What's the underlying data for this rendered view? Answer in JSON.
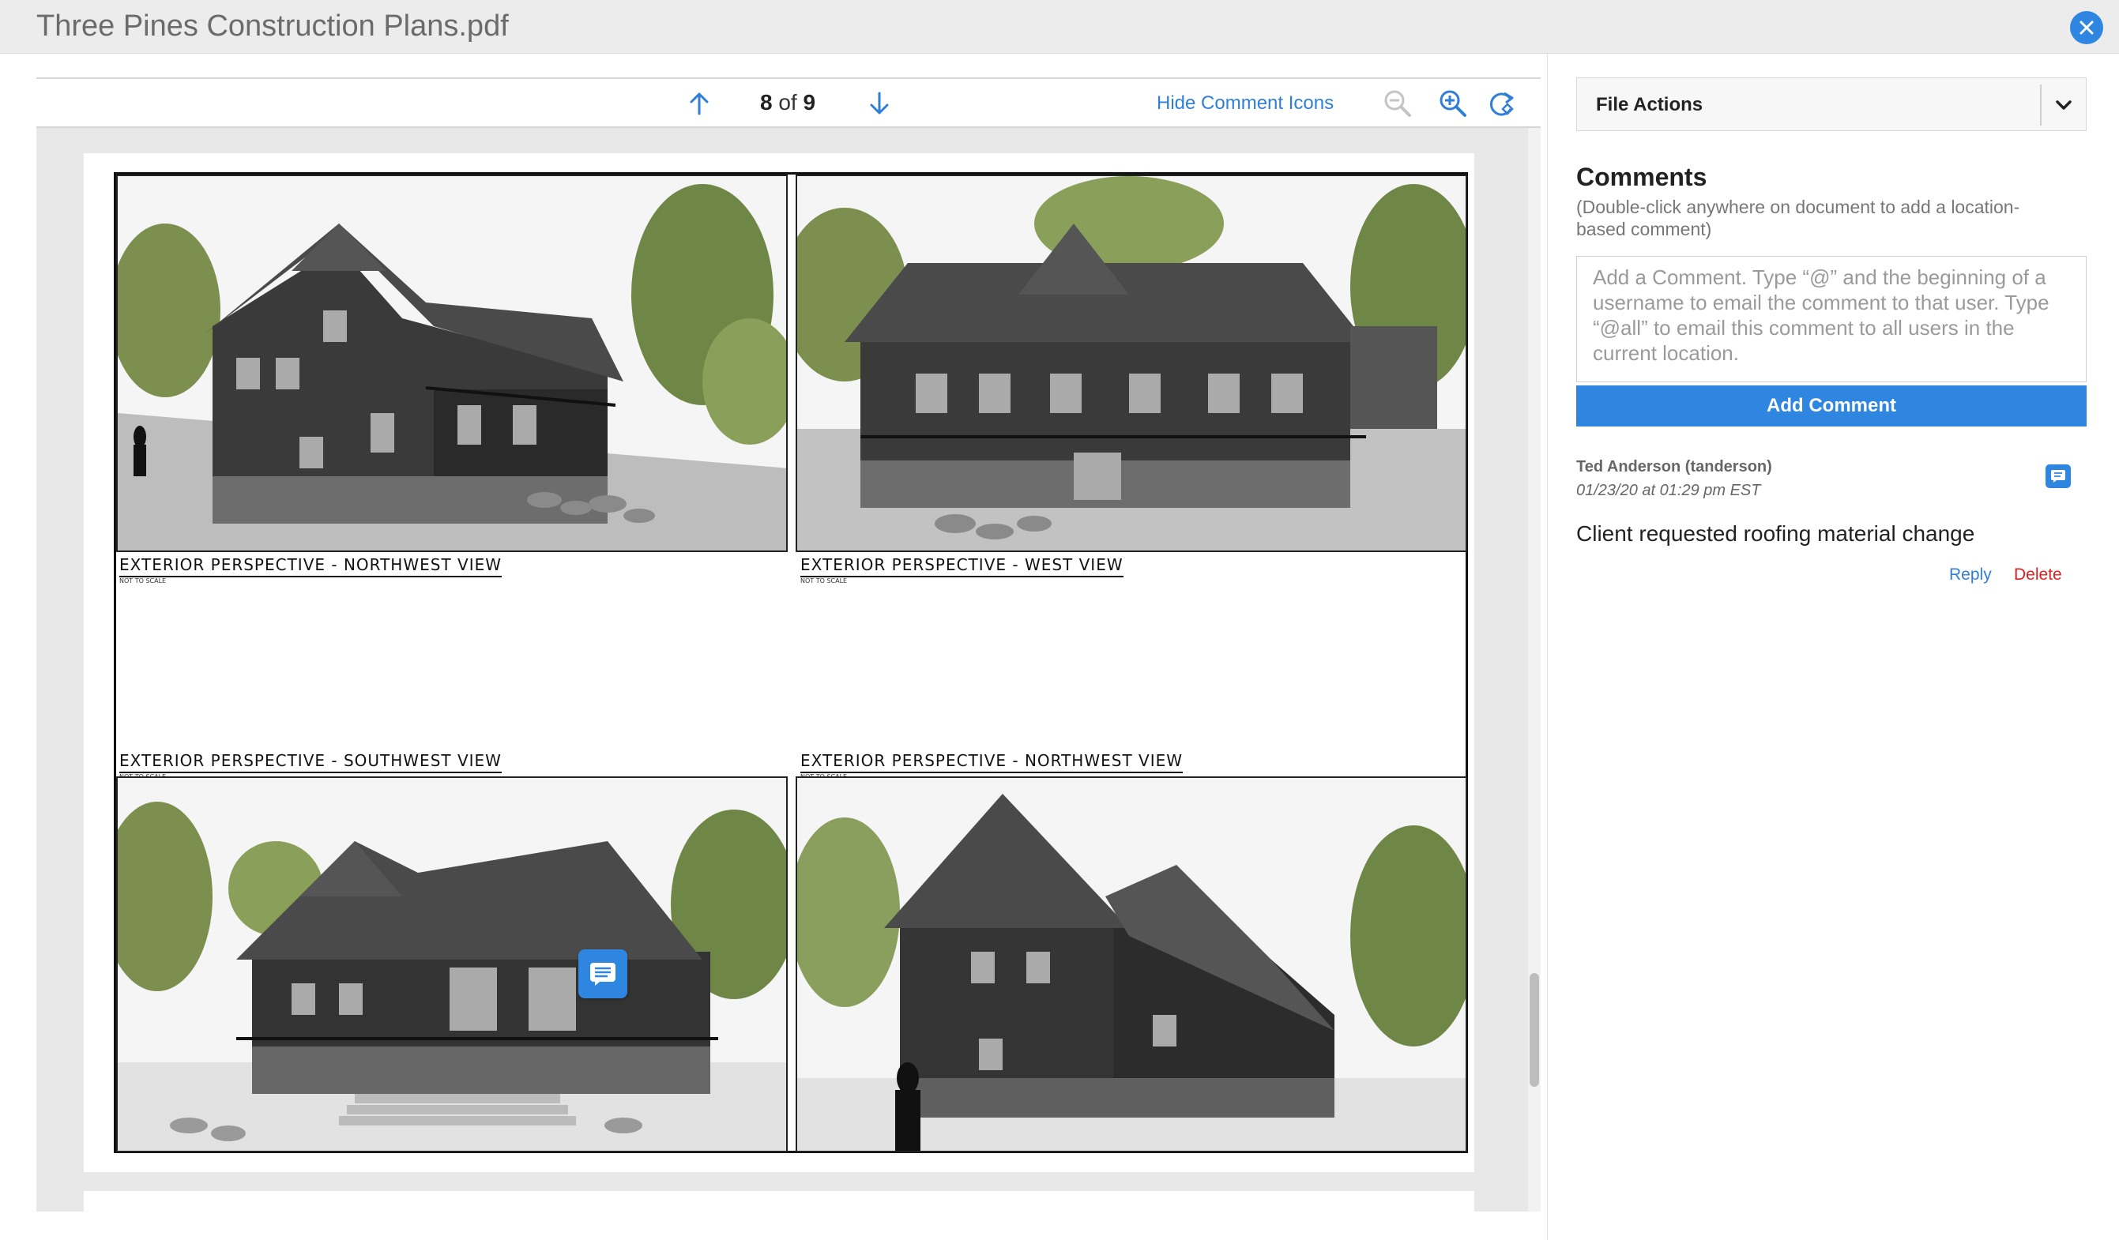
{
  "window": {
    "title": "Three Pines Construction Plans.pdf",
    "close_icon": "close-icon"
  },
  "toolbar": {
    "current_page": "8",
    "of_text": "of",
    "total_pages": "9",
    "hide_comment_icons_label": "Hide Comment Icons",
    "icons": [
      "arrow-up-icon",
      "arrow-down-icon",
      "zoom-out-icon",
      "zoom-in-icon",
      "rotate-icon"
    ]
  },
  "document": {
    "views": [
      {
        "caption": "Exterior Perspective - Northwest View",
        "subcaption": "Not to scale"
      },
      {
        "caption": "Exterior Perspective - West View",
        "subcaption": "Not to scale"
      },
      {
        "caption": "Exterior Perspective - Southwest View",
        "subcaption": "Not to scale"
      },
      {
        "caption": "Exterior Perspective - Northwest View",
        "subcaption": "Not to scale"
      }
    ],
    "comment_pin_icon": "comment-icon"
  },
  "sidebar": {
    "file_actions_label": "File Actions",
    "comments_heading": "Comments",
    "comments_hint": "(Double-click anywhere on document to add a location-based comment)",
    "comment_placeholder": "Add a Comment. Type “@” and the beginning of a username to email the comment to that user. Type “@all” to email this comment to all users in the current location.",
    "add_comment_label": "Add Comment",
    "comments": [
      {
        "author": "Ted Anderson (tanderson)",
        "date": "01/23/20 at 01:29 pm EST",
        "text": "Client requested roofing material change",
        "reply_label": "Reply",
        "delete_label": "Delete"
      }
    ]
  },
  "colors": {
    "accent": "#2f86e0",
    "link": "#2f7fd8",
    "danger": "#e02020"
  }
}
